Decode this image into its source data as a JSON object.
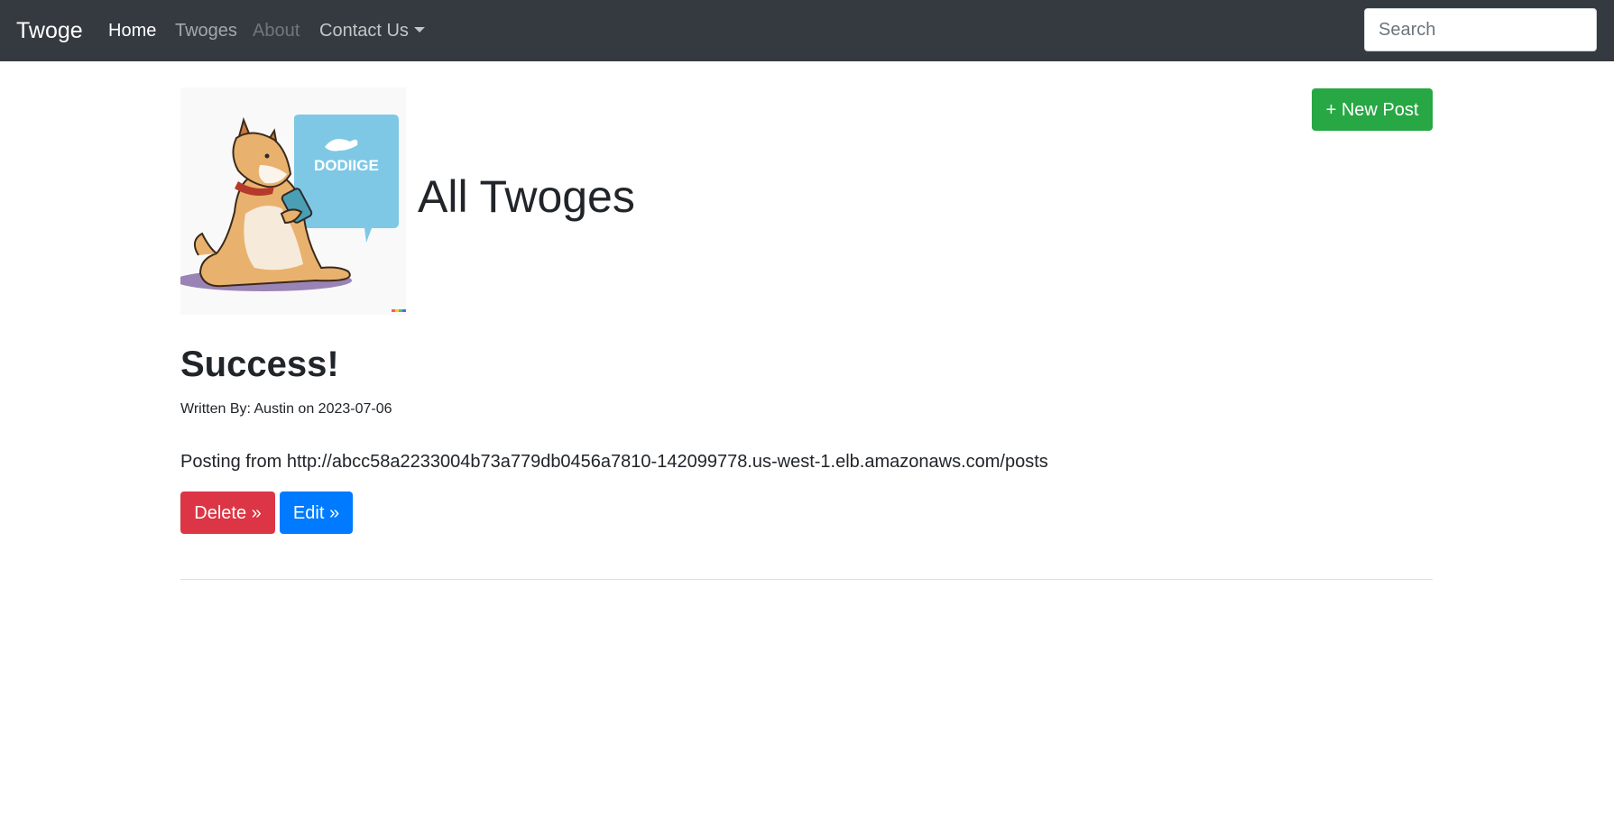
{
  "navbar": {
    "brand": "Twoge",
    "links": [
      {
        "label": "Home",
        "state": "active"
      },
      {
        "label": "Twoges",
        "state": "normal"
      },
      {
        "label": "About",
        "state": "disabled"
      },
      {
        "label": "Contact Us",
        "state": "dropdown"
      }
    ],
    "search": {
      "placeholder": "Search",
      "value": ""
    }
  },
  "header": {
    "logo_text": "DODIIGE",
    "title": "All Twoges",
    "new_post_label": "+ New Post"
  },
  "posts": [
    {
      "title": "Success!",
      "meta": "Written By: Austin on 2023-07-06",
      "body": "Posting from http://abcc58a2233004b73a779db0456a7810-142099778.us-west-1.elb.amazonaws.com/posts",
      "delete_label": "Delete »",
      "edit_label": "Edit »"
    }
  ],
  "colors": {
    "navbar_bg": "#343a40",
    "success": "#28a745",
    "danger": "#dc3545",
    "primary": "#007bff"
  }
}
